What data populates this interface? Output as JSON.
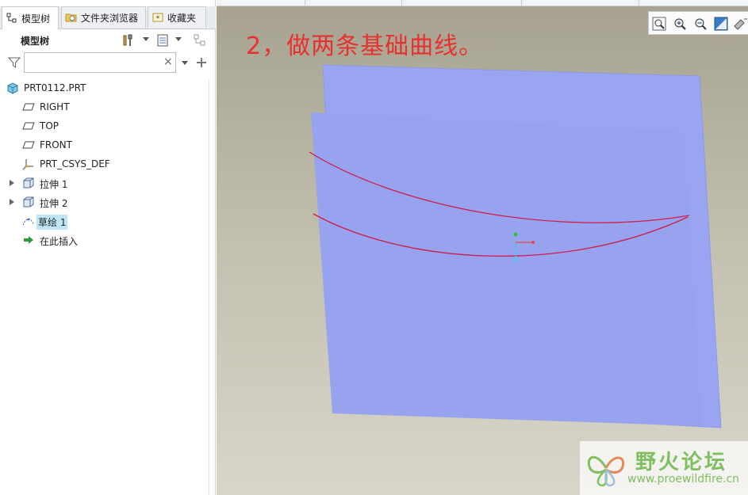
{
  "tabs": [
    {
      "label": "模型树",
      "icon": "model-tree-icon",
      "active": true
    },
    {
      "label": "文件夹浏览器",
      "icon": "folder-browser-icon",
      "active": false
    },
    {
      "label": "收藏夹",
      "icon": "favorites-icon",
      "active": false
    }
  ],
  "toolbar": {
    "title": "模型树",
    "settings_icon": "tools-icon",
    "show_icon": "show-list-icon",
    "filter_icon": "tree-filter-icon"
  },
  "search": {
    "value": "",
    "placeholder": "",
    "clear_glyph": "×"
  },
  "tree": {
    "items": [
      {
        "label": "PRT0112.PRT",
        "icon": "part-icon",
        "expandable": false,
        "selected": false
      },
      {
        "label": "RIGHT",
        "icon": "datum-plane-icon",
        "expandable": false,
        "selected": false
      },
      {
        "label": "TOP",
        "icon": "datum-plane-icon",
        "expandable": false,
        "selected": false
      },
      {
        "label": "FRONT",
        "icon": "datum-plane-icon",
        "expandable": false,
        "selected": false
      },
      {
        "label": "PRT_CSYS_DEF",
        "icon": "csys-icon",
        "expandable": false,
        "selected": false
      },
      {
        "label": "拉伸 1",
        "icon": "extrude-icon",
        "expandable": true,
        "selected": false
      },
      {
        "label": "拉伸 2",
        "icon": "extrude-icon",
        "expandable": true,
        "selected": false
      },
      {
        "label": "草绘 1",
        "icon": "sketch-icon",
        "expandable": false,
        "selected": true
      },
      {
        "label": "在此插入",
        "icon": "insert-here-icon",
        "expandable": false,
        "selected": false
      }
    ]
  },
  "viewport": {
    "annotation": "2，做两条基础曲线。",
    "tools": [
      "zoom-fit-icon",
      "zoom-in-icon",
      "zoom-out-icon",
      "repaint-icon",
      "more-icon"
    ]
  },
  "watermark": {
    "name": "野火论坛",
    "url": "www.proewildfire.cn"
  },
  "colors": {
    "annotation": "#e8302f",
    "surface": "#9aa8f0",
    "curve": "#d01a4a",
    "selection": "#bfe6f8",
    "watermark": "#7fbf5f"
  }
}
